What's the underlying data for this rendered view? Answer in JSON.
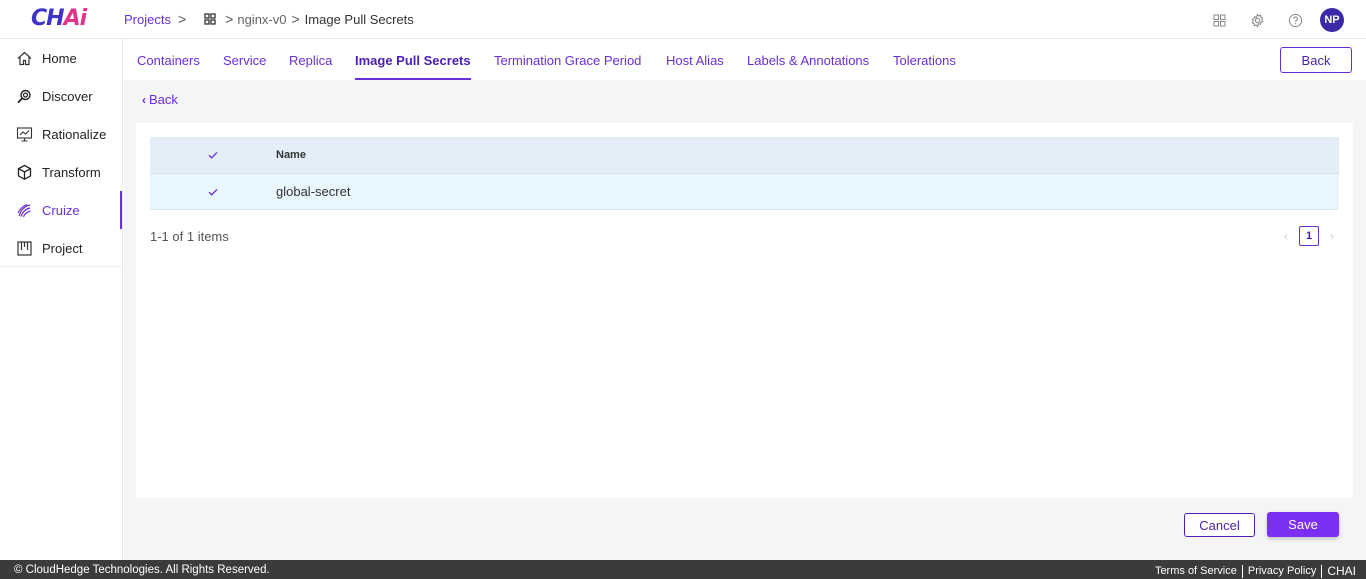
{
  "header": {
    "logo": {
      "prefix": "CH",
      "accent": "Ai"
    },
    "breadcrumb": {
      "projects": "Projects",
      "project": "nginx-v0",
      "current": "Image Pull Secrets"
    },
    "user_initials": "NP"
  },
  "sidebar": {
    "items": [
      {
        "label": "Home",
        "icon": "home-icon"
      },
      {
        "label": "Discover",
        "icon": "discover-icon"
      },
      {
        "label": "Rationalize",
        "icon": "rationalize-icon"
      },
      {
        "label": "Transform",
        "icon": "cube-icon"
      },
      {
        "label": "Cruize",
        "icon": "cruize-icon",
        "active": true
      },
      {
        "label": "Project",
        "icon": "project-icon"
      }
    ]
  },
  "tabs": [
    {
      "label": "Containers"
    },
    {
      "label": "Service"
    },
    {
      "label": "Replica"
    },
    {
      "label": "Image Pull Secrets",
      "active": true
    },
    {
      "label": "Termination Grace Period"
    },
    {
      "label": "Host Alias"
    },
    {
      "label": "Labels & Annotations"
    },
    {
      "label": "Tolerations"
    }
  ],
  "actions": {
    "back_top": "Back",
    "back_link": "Back",
    "cancel": "Cancel",
    "save": "Save"
  },
  "table": {
    "header_name": "Name",
    "rows": [
      {
        "name": "global-secret",
        "checked": true
      }
    ],
    "count_text": "1-1 of 1 items",
    "page": "1"
  },
  "footer": {
    "copyright": "© CloudHedge Technologies. All Rights Reserved.",
    "terms": "Terms of Service",
    "privacy": "Privacy Policy",
    "brand": "CHAI"
  },
  "colors": {
    "accent": "#6b2fd9",
    "brand": "#3f32c9",
    "save_bg": "#7b2ff2"
  }
}
